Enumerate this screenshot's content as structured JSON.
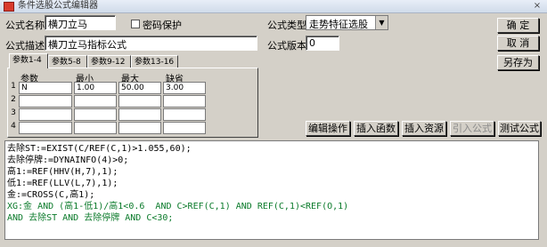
{
  "window": {
    "title": "条件选股公式编辑器",
    "close": "×"
  },
  "form": {
    "name_label": "公式名称",
    "name_value": "横刀立马",
    "password_label": "密码保护",
    "desc_label": "公式描述",
    "desc_value": "横刀立马指标公式",
    "type_label": "公式类型",
    "type_value": "走势特征选股",
    "version_label": "公式版本",
    "version_value": "0"
  },
  "buttons": {
    "ok": "确  定",
    "cancel": "取  消",
    "save_as": "另存为",
    "edit_ops": "编辑操作",
    "insert_func": "插入函数",
    "insert_resource": "插入资源",
    "import_formula": "引入公式",
    "test_formula": "测试公式"
  },
  "tabs": [
    "参数1-4",
    "参数5-8",
    "参数9-12",
    "参数13-16"
  ],
  "params": {
    "headers": [
      "参数",
      "最小",
      "最大",
      "缺省"
    ],
    "rows": [
      {
        "num": "1",
        "cells": [
          "N",
          "1.00",
          "50.00",
          "3.00"
        ]
      },
      {
        "num": "2",
        "cells": [
          "",
          "",
          "",
          ""
        ]
      },
      {
        "num": "3",
        "cells": [
          "",
          "",
          "",
          ""
        ]
      },
      {
        "num": "4",
        "cells": [
          "",
          "",
          "",
          ""
        ]
      }
    ]
  },
  "code_lines": [
    "去除ST:=EXIST(C/REF(C,1)>1.055,60);",
    "去除停牌:=DYNAINFO(4)>0;",
    "高1:=REF(HHV(H,7),1);",
    "低1:=REF(LLV(L,7),1);",
    "金:=CROSS(C,高1);",
    "XG:金 AND (高1-低1)/高1<0.6  AND C>REF(C,1) AND REF(C,1)<REF(O,1)",
    "AND 去除ST AND 去除停牌 AND C<30;"
  ],
  "colors": {
    "keyword": "#1f3fb3",
    "number": "#7a7a7a",
    "highlight": "#0a7a2a"
  }
}
